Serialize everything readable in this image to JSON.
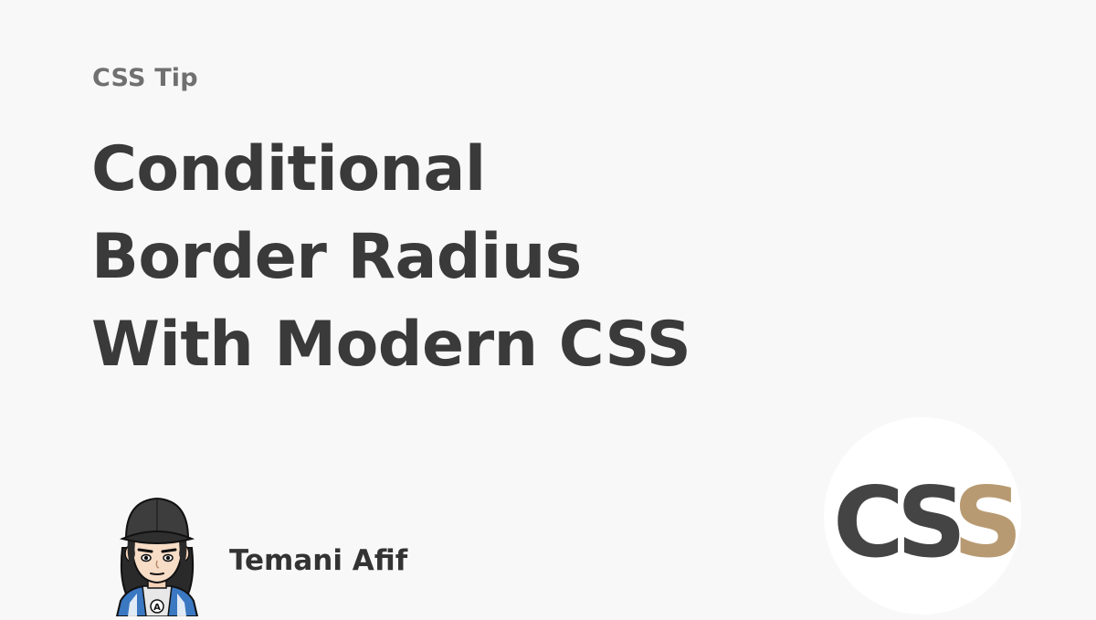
{
  "kicker": "CSS Tip",
  "title_lines": [
    "Conditional",
    "Border Radius",
    "With Modern CSS"
  ],
  "author": {
    "name": "Temani Afif",
    "avatar_icon": "cartoon-avatar-icon",
    "avatar_badge": "A"
  },
  "logo": {
    "icon": "css-logo-icon",
    "text_dark": "CS",
    "text_accent": "S",
    "dark_color": "#444444",
    "accent_color": "#b89a72",
    "circle_color": "#ffffff"
  },
  "colors": {
    "background": "#f8f8f8",
    "title": "#3a3a3a",
    "kicker": "#707070"
  }
}
